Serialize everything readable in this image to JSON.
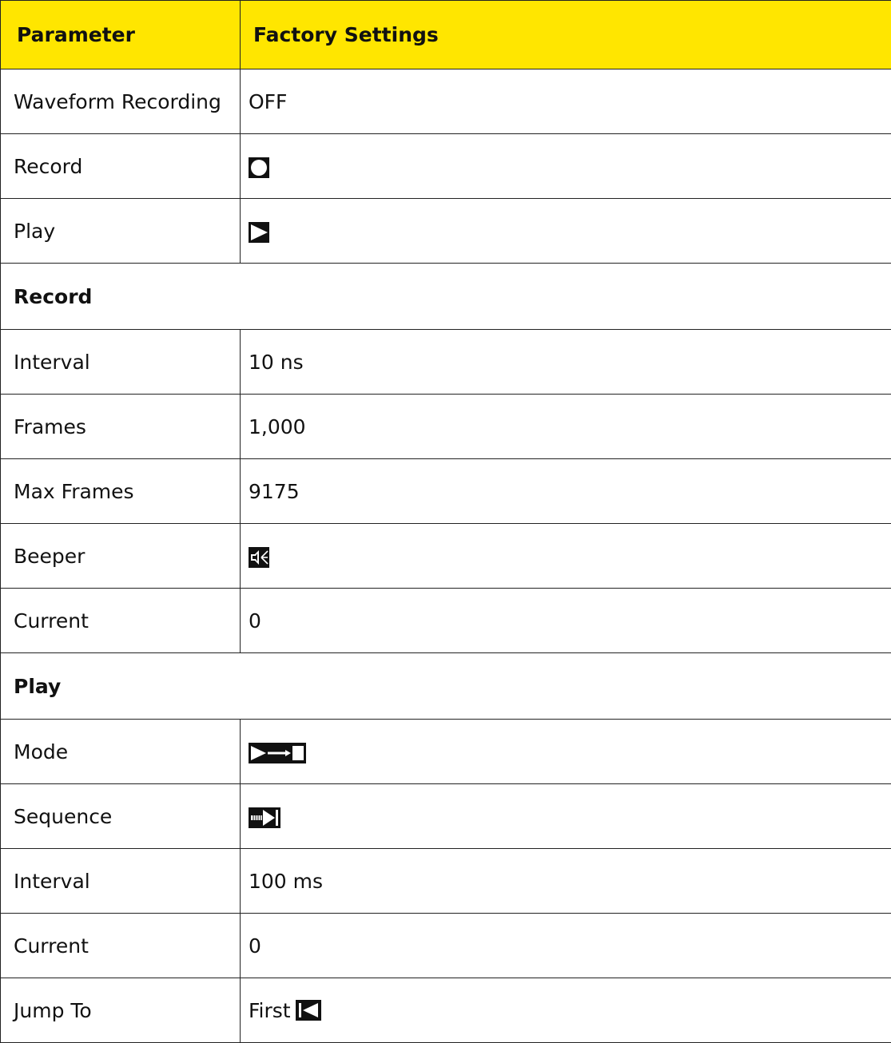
{
  "table": {
    "header": {
      "col1": "Parameter",
      "col2": "Factory Settings"
    },
    "rows": {
      "r0": {
        "param": "Waveform Recording",
        "value": "OFF"
      },
      "r1": {
        "param": "Record",
        "icon": "record-circle-icon"
      },
      "r2": {
        "param": "Play",
        "icon": "play-triangle-icon"
      },
      "s1": {
        "section": "Record"
      },
      "r3": {
        "param": "Interval",
        "value": "10 ns"
      },
      "r4": {
        "param": "Frames",
        "value": "1,000"
      },
      "r5": {
        "param": "Max Frames",
        "value": "9175"
      },
      "r6": {
        "param": "Beeper",
        "icon": "speaker-mute-icon"
      },
      "r7": {
        "param": "Current",
        "value": "0"
      },
      "s2": {
        "section": "Play"
      },
      "r8": {
        "param": "Mode",
        "icon": "play-once-mode-icon"
      },
      "r9": {
        "param": "Sequence",
        "icon": "sequence-forward-icon"
      },
      "r10": {
        "param": "Interval",
        "value": "100 ms"
      },
      "r11": {
        "param": "Current",
        "value": "0"
      },
      "r12": {
        "param": "Jump To",
        "value": "First",
        "icon": "jump-first-icon"
      }
    }
  },
  "colors": {
    "header_bg": "#ffe600",
    "border": "#222222",
    "icon": "#111111"
  }
}
